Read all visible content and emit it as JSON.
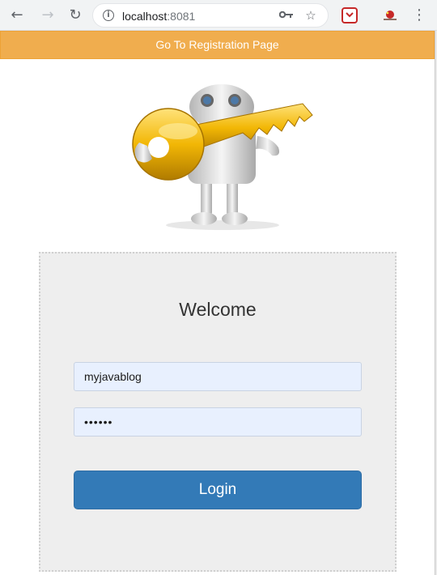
{
  "browser": {
    "url_host": "localhost",
    "url_port": ":8081",
    "icons": [
      "back-arrow-icon",
      "forward-arrow-icon",
      "reload-icon",
      "info-icon",
      "key-icon",
      "star-icon",
      "pocket-icon",
      "extension-icon",
      "menu-dots-icon"
    ]
  },
  "header": {
    "registration_link": "Go To Registration Page"
  },
  "login": {
    "title": "Welcome",
    "username_value": "myjavablog",
    "password_value": "••••••",
    "login_label": "Login"
  },
  "colors": {
    "registration_bar": "#f0ad4e",
    "login_button": "#337ab7",
    "input_fill": "#e8f0fe",
    "card_background": "#eeeeee"
  }
}
